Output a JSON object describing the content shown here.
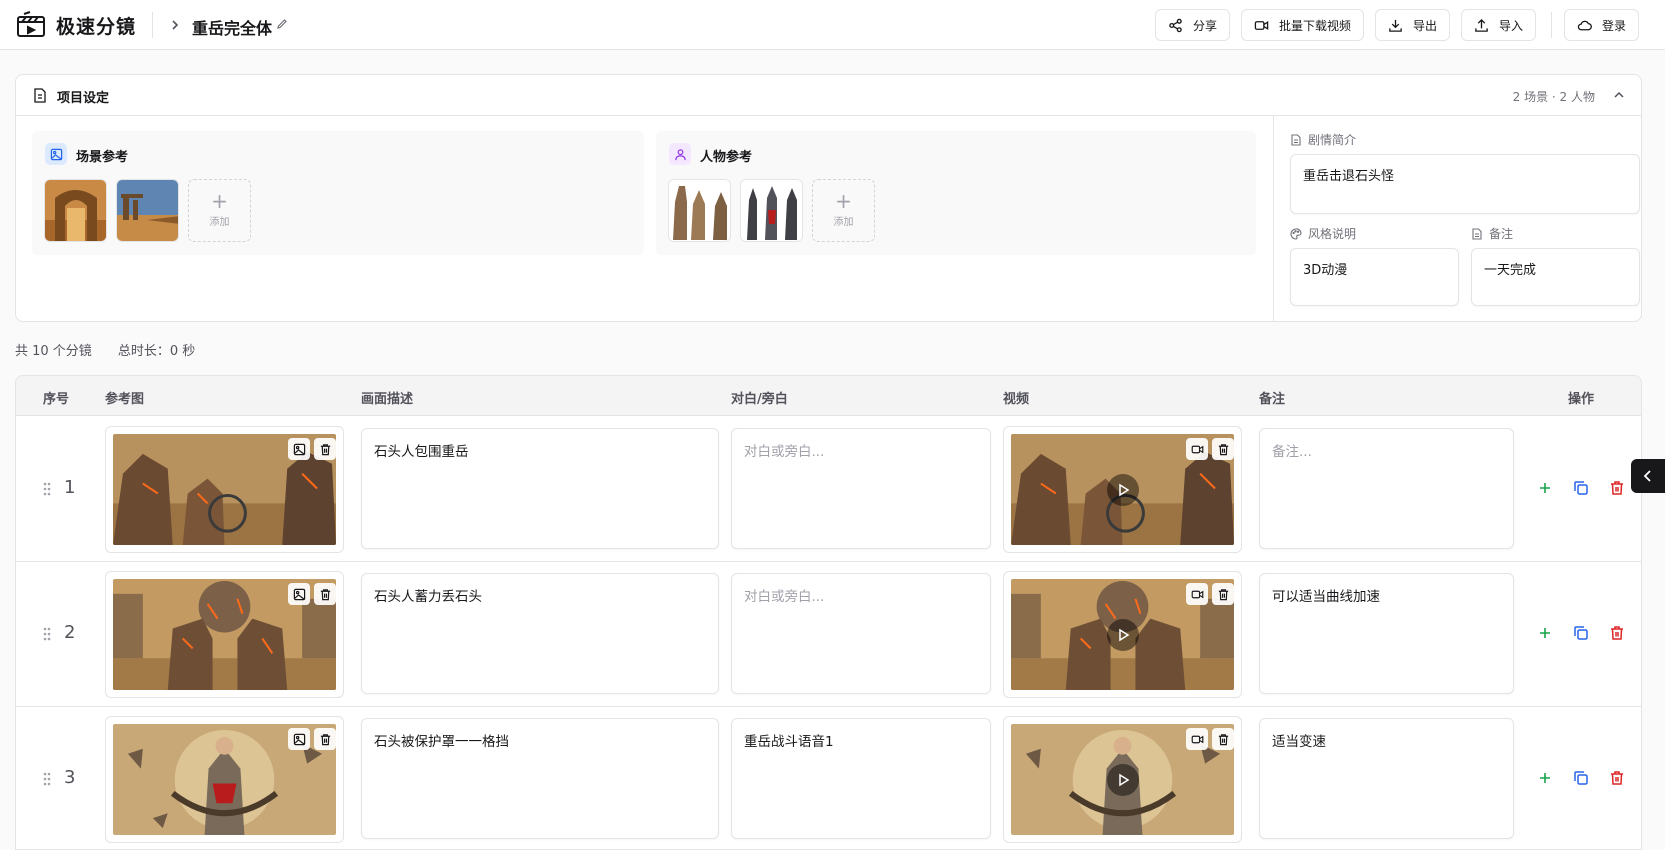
{
  "header": {
    "brand": "极速分镜",
    "project_title": "重岳完全体",
    "buttons": {
      "share": "分享",
      "batch_download": "批量下载视频",
      "export": "导出",
      "import": "导入",
      "login": "登录"
    }
  },
  "settings": {
    "title": "项目设定",
    "counts": "2 场景 · 2 人物",
    "scene_ref": {
      "title": "场景参考",
      "add_label": "添加"
    },
    "character_ref": {
      "title": "人物参考",
      "add_label": "添加"
    },
    "synopsis": {
      "label": "剧情简介",
      "value": "重岳击退石头怪"
    },
    "style": {
      "label": "风格说明",
      "value": "3D动漫"
    },
    "notes": {
      "label": "备注",
      "value": "一天完成"
    }
  },
  "summary": {
    "shot_count": "共 10 个分镜",
    "duration": "总时长：0 秒"
  },
  "table": {
    "headers": {
      "index": "序号",
      "ref_image": "参考图",
      "description": "画面描述",
      "dialogue": "对白/旁白",
      "video": "视频",
      "note": "备注",
      "actions": "操作"
    },
    "rows": [
      {
        "index": "1",
        "description": "石头人包围重岳",
        "dialogue": "",
        "dialogue_placeholder": "对白或旁白...",
        "note": "",
        "note_placeholder": "备注..."
      },
      {
        "index": "2",
        "description": "石头人蓄力丢石头",
        "dialogue": "",
        "dialogue_placeholder": "对白或旁白...",
        "note": "可以适当曲线加速",
        "note_placeholder": "备注..."
      },
      {
        "index": "3",
        "description": "石头被保护罩一一格挡",
        "dialogue": "重岳战斗语音1",
        "dialogue_placeholder": "对白或旁白...",
        "note": "适当变速",
        "note_placeholder": "备注..."
      }
    ]
  },
  "colors": {
    "accent_green": "#16a34a",
    "accent_blue": "#2563eb",
    "accent_red": "#dc2626",
    "border": "#e4e4e7"
  },
  "icons": [
    "film-logo-icon",
    "chevron-right-icon",
    "pencil-icon",
    "share-icon",
    "video-icon",
    "download-icon",
    "upload-icon",
    "cloud-icon",
    "document-icon",
    "chevron-up-icon",
    "image-icon",
    "user-icon",
    "palette-icon",
    "grip-icon",
    "trash-icon",
    "play-icon",
    "plus-icon",
    "copy-icon",
    "chevron-left-icon"
  ]
}
